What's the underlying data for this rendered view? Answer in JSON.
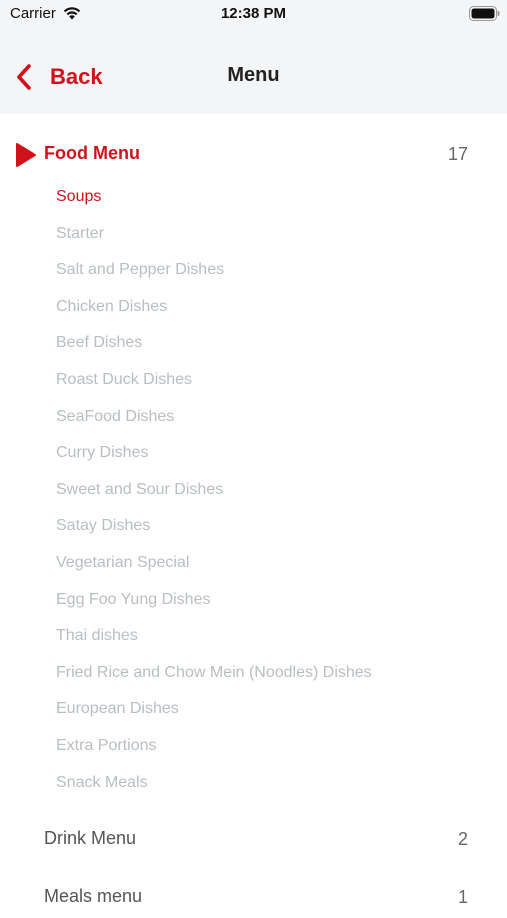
{
  "status_bar": {
    "carrier": "Carrier",
    "time": "12:38 PM"
  },
  "navbar": {
    "back_label": "Back",
    "title": "Menu"
  },
  "colors": {
    "accent": "#d0121b",
    "inactive_item": "#b8bec2",
    "nav_background": "#f4f5f7"
  },
  "sections": [
    {
      "title": "Food Menu",
      "count": "17",
      "expanded": true
    },
    {
      "title": "Drink Menu",
      "count": "2",
      "expanded": false
    },
    {
      "title": "Meals menu",
      "count": "1",
      "expanded": false
    }
  ],
  "food_menu_items": [
    {
      "label": "Soups",
      "active": true
    },
    {
      "label": "Starter"
    },
    {
      "label": "Salt and Pepper Dishes"
    },
    {
      "label": "Chicken Dishes"
    },
    {
      "label": "Beef Dishes"
    },
    {
      "label": "Roast Duck Dishes"
    },
    {
      "label": "SeaFood Dishes"
    },
    {
      "label": "Curry Dishes"
    },
    {
      "label": "Sweet and Sour Dishes"
    },
    {
      "label": "Satay Dishes"
    },
    {
      "label": "Vegetarian Special"
    },
    {
      "label": "Egg Foo Yung Dishes"
    },
    {
      "label": "Thai dishes"
    },
    {
      "label": "Fried Rice and Chow Mein (Noodles) Dishes"
    },
    {
      "label": "European Dishes"
    },
    {
      "label": "Extra Portions"
    },
    {
      "label": "Snack Meals"
    }
  ]
}
